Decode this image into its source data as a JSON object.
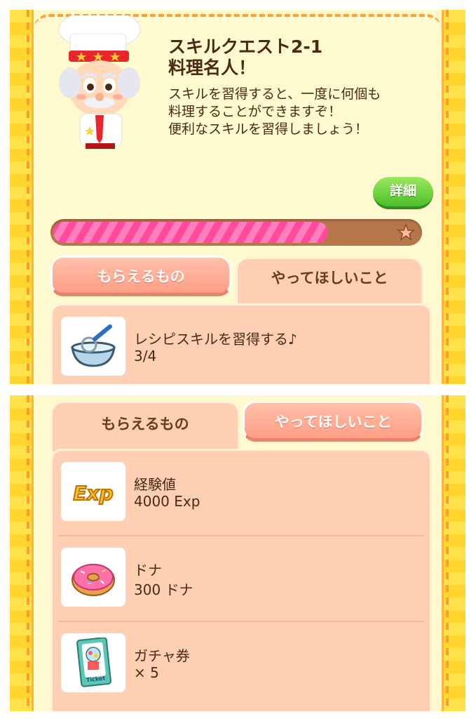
{
  "quest": {
    "title": "スキルクエスト2-1\n料理名人！",
    "description": "スキルを習得すると、一度に何個も\n料理することができますぞ！\n便利なスキルを習得しましょう！",
    "detail_label": "詳細",
    "progress_fraction": 0.75
  },
  "top_panel": {
    "tabs": [
      {
        "label": "もらえるもの",
        "state": "inactive"
      },
      {
        "label": "やってほしいこと",
        "state": "active"
      }
    ],
    "tasks": [
      {
        "icon": "whisk-bowl-icon",
        "name": "レシピスキルを習得する♪",
        "value": "3/4"
      }
    ]
  },
  "bottom_panel": {
    "tabs": [
      {
        "label": "もらえるもの",
        "state": "active"
      },
      {
        "label": "やってほしいこと",
        "state": "inactive"
      }
    ],
    "rewards": [
      {
        "icon": "exp-icon",
        "name": "経験値",
        "value": "4000 Exp",
        "icon_text": "Exp"
      },
      {
        "icon": "donut-icon",
        "name": "ドナ",
        "value": "300 ドナ"
      },
      {
        "icon": "gacha-ticket-icon",
        "name": "ガチャ券",
        "value": "× 5",
        "icon_text": "Ticket"
      }
    ]
  },
  "colors": {
    "panel_bg": "#fff9cf",
    "frame_yellow": "#ffe14a",
    "tab_peach": "#ffcfb4",
    "progress_pink": "#ff4aa0",
    "detail_green": "#4cbf2a",
    "text_brown": "#4a2a14"
  }
}
